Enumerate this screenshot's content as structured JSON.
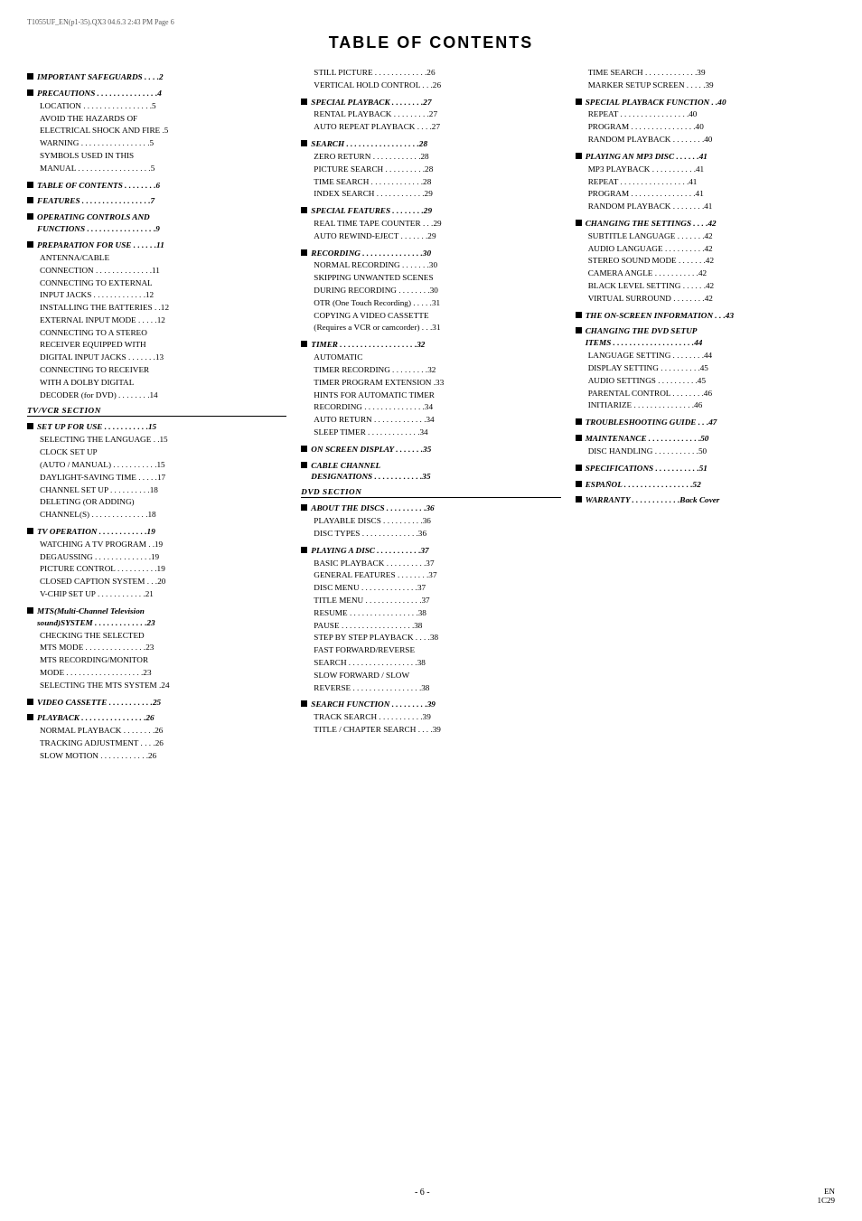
{
  "header": {
    "left": "T1055UF_EN(p1-35).QX3   04.6.3   2:43 PM   Page 6"
  },
  "title": "TABLE OF CONTENTS",
  "footer": {
    "center": "- 6 -",
    "right_line1": "EN",
    "right_line2": "1C29"
  },
  "col1": [
    {
      "type": "section",
      "text": "IMPORTANT SAFEGUARDS  . . . .2"
    },
    {
      "type": "section",
      "text": "PRECAUTIONS  . . . . . . . . . . . . . . .4"
    },
    {
      "type": "sub",
      "text": "LOCATION  . . . . . . . . . . . . . . . . .5"
    },
    {
      "type": "sub",
      "text": "AVOID THE HAZARDS OF\nELECTRICAL SHOCK AND FIRE  .5"
    },
    {
      "type": "sub",
      "text": "WARNING  . . . . . . . . . . . . . . . . .5"
    },
    {
      "type": "sub",
      "text": "SYMBOLS USED IN THIS\nMANUAL . . . . . . . . . . . . . . . . . .5"
    },
    {
      "type": "section",
      "text": "TABLE OF CONTENTS  . . . . . . . .6"
    },
    {
      "type": "section",
      "text": "FEATURES . . . . . . . . . . . . . . . . .7"
    },
    {
      "type": "section",
      "text": "OPERATING CONTROLS AND\nFUNCTIONS . . . . . . . . . . . . . . . . .9"
    },
    {
      "type": "section",
      "text": "PREPARATION FOR USE  . . . . . .11"
    },
    {
      "type": "sub",
      "text": "ANTENNA/CABLE\nCONNECTION . . . . . . . . . . . . . .11"
    },
    {
      "type": "sub",
      "text": "CONNECTING TO EXTERNAL\nINPUT JACKS  . . . . . . . . . . . . .12"
    },
    {
      "type": "sub",
      "text": "INSTALLING THE BATTERIES  . .12"
    },
    {
      "type": "sub",
      "text": "EXTERNAL INPUT MODE  . . . . .12"
    },
    {
      "type": "sub",
      "text": "CONNECTING TO A STEREO\nRECEIVER EQUIPPED WITH\nDIGITAL INPUT JACKS  . . . . . . .13"
    },
    {
      "type": "sub",
      "text": "CONNECTING TO RECEIVER\nWITH A DOLBY DIGITAL\nDECODER (for DVD)  . . . . . . . .14"
    },
    {
      "type": "divider",
      "text": "TV/VCR SECTION"
    },
    {
      "type": "section",
      "text": "SET UP FOR USE  . . . . . . . . . . .15"
    },
    {
      "type": "sub",
      "text": "SELECTING THE LANGUAGE  . .15"
    },
    {
      "type": "sub",
      "text": "CLOCK SET UP\n(AUTO / MANUAL) . . . . . . . . . . .15"
    },
    {
      "type": "sub",
      "text": "DAYLIGHT-SAVING TIME  . . . . .17"
    },
    {
      "type": "sub",
      "text": "CHANNEL SET UP  . . . . . . . . . .18"
    },
    {
      "type": "sub",
      "text": "DELETING (OR ADDING)\nCHANNEL(S) . . . . . . . . . . . . . .18"
    },
    {
      "type": "section",
      "text": "TV OPERATION  . . . . . . . . . . . .19"
    },
    {
      "type": "sub",
      "text": "WATCHING A TV PROGRAM  . .19"
    },
    {
      "type": "sub",
      "text": "DEGAUSSING  . . . . . . . . . . . . . .19"
    },
    {
      "type": "sub",
      "text": "PICTURE CONTROL . . . . . . . . . .19"
    },
    {
      "type": "sub",
      "text": "CLOSED CAPTION SYSTEM  . . .20"
    },
    {
      "type": "sub",
      "text": "V-CHIP SET UP  . . . . . . . . . . . .21"
    },
    {
      "type": "section",
      "text": "MTS(Multi-Channel Television\nsound)SYSTEM  . . . . . . . . . . . . .23"
    },
    {
      "type": "sub",
      "text": "CHECKING THE SELECTED\nMTS MODE  . . . . . . . . . . . . . . .23"
    },
    {
      "type": "sub",
      "text": "MTS RECORDING/MONITOR\nMODE  . . . . . . . . . . . . . . . . . . .23"
    },
    {
      "type": "sub",
      "text": "SELECTING THE MTS SYSTEM  .24"
    },
    {
      "type": "section",
      "text": "VIDEO CASSETTE . . . . . . . . . . .25"
    },
    {
      "type": "section",
      "text": "PLAYBACK  . . . . . . . . . . . . . . . .26"
    },
    {
      "type": "sub",
      "text": "NORMAL PLAYBACK  . . . . . . . .26"
    },
    {
      "type": "sub",
      "text": "TRACKING ADJUSTMENT  . . . .26"
    },
    {
      "type": "sub",
      "text": "SLOW MOTION  . . . . . . . . . . . .26"
    }
  ],
  "col2": [
    {
      "type": "sub",
      "text": "STILL PICTURE  . . . . . . . . . . . . .26"
    },
    {
      "type": "sub",
      "text": "VERTICAL HOLD CONTROL  . . .26"
    },
    {
      "type": "section",
      "text": "SPECIAL PLAYBACK  . . . . . . . .27"
    },
    {
      "type": "sub",
      "text": "RENTAL PLAYBACK  . . . . . . . . .27"
    },
    {
      "type": "sub",
      "text": "AUTO REPEAT PLAYBACK  . . . .27"
    },
    {
      "type": "section",
      "text": "SEARCH  . . . . . . . . . . . . . . . . . .28"
    },
    {
      "type": "sub",
      "text": "ZERO RETURN  . . . . . . . . . . . .28"
    },
    {
      "type": "sub",
      "text": "PICTURE SEARCH  . . . . . . . . . .28"
    },
    {
      "type": "sub",
      "text": "TIME SEARCH  . . . . . . . . . . . . .28"
    },
    {
      "type": "sub",
      "text": "INDEX SEARCH  . . . . . . . . . . . .29"
    },
    {
      "type": "section",
      "text": "SPECIAL FEATURES  . . . . . . . .29"
    },
    {
      "type": "sub",
      "text": "REAL TIME TAPE COUNTER  . . .29"
    },
    {
      "type": "sub",
      "text": "AUTO REWIND-EJECT  . . . . . . .29"
    },
    {
      "type": "section",
      "text": "RECORDING  . . . . . . . . . . . . . . .30"
    },
    {
      "type": "sub",
      "text": "NORMAL RECORDING  . . . . . . .30"
    },
    {
      "type": "sub",
      "text": "SKIPPING UNWANTED SCENES\nDURING RECORDING  . . . . . . . .30"
    },
    {
      "type": "sub",
      "text": "OTR (One Touch Recording) . . . . .31"
    },
    {
      "type": "sub",
      "text": "COPYING A VIDEO CASSETTE\n(Requires a VCR or camcorder)  . . .31"
    },
    {
      "type": "section",
      "text": "TIMER  . . . . . . . . . . . . . . . . . . .32"
    },
    {
      "type": "sub",
      "text": "AUTOMATIC\nTIMER RECORDING  . . . . . . . . .32"
    },
    {
      "type": "sub",
      "text": "TIMER PROGRAM EXTENSION  .33"
    },
    {
      "type": "sub",
      "text": "HINTS FOR AUTOMATIC TIMER\nRECORDING . . . . . . . . . . . . . . .34"
    },
    {
      "type": "sub",
      "text": "AUTO RETURN . . . . . . . . . . . . .34"
    },
    {
      "type": "sub",
      "text": "SLEEP TIMER  . . . . . . . . . . . . .34"
    },
    {
      "type": "section",
      "text": "ON SCREEN DISPLAY  . . . . . . .35"
    },
    {
      "type": "section",
      "text": "CABLE CHANNEL\nDESIGNATIONS  . . . . . . . . . . . .35"
    },
    {
      "type": "divider",
      "text": "DVD SECTION"
    },
    {
      "type": "section",
      "text": "ABOUT THE DISCS  . . . . . . . . . .36"
    },
    {
      "type": "sub",
      "text": "PLAYABLE DISCS  . . . . . . . . . .36"
    },
    {
      "type": "sub",
      "text": "DISC TYPES  . . . . . . . . . . . . . .36"
    },
    {
      "type": "section",
      "text": "PLAYING A DISC  . . . . . . . . . . .37"
    },
    {
      "type": "sub",
      "text": "BASIC PLAYBACK  . . . . . . . . . .37"
    },
    {
      "type": "sub",
      "text": "GENERAL FEATURES  . . . . . . . .37"
    },
    {
      "type": "sub",
      "text": "DISC MENU  . . . . . . . . . . . . . .37"
    },
    {
      "type": "sub",
      "text": "TITLE MENU  . . . . . . . . . . . . . .37"
    },
    {
      "type": "sub",
      "text": "RESUME  . . . . . . . . . . . . . . . . .38"
    },
    {
      "type": "sub",
      "text": "PAUSE  . . . . . . . . . . . . . . . . . .38"
    },
    {
      "type": "sub",
      "text": "STEP BY STEP PLAYBACK  . . . .38"
    },
    {
      "type": "sub",
      "text": "FAST FORWARD/REVERSE\nSEARCH  . . . . . . . . . . . . . . . . .38"
    },
    {
      "type": "sub",
      "text": "SLOW FORWARD / SLOW\nREVERSE . . . . . . . . . . . . . . . . .38"
    },
    {
      "type": "section",
      "text": "SEARCH FUNCTION . . . . . . . . .39"
    },
    {
      "type": "sub",
      "text": "TRACK SEARCH  . . . . . . . . . . .39"
    },
    {
      "type": "sub",
      "text": "TITLE / CHAPTER SEARCH  . . . .39"
    }
  ],
  "col3": [
    {
      "type": "sub",
      "text": "TIME SEARCH  . . . . . . . . . . . . .39"
    },
    {
      "type": "sub",
      "text": "MARKER SETUP SCREEN  . . . . .39"
    },
    {
      "type": "section",
      "text": "SPECIAL PLAYBACK FUNCTION  . .40"
    },
    {
      "type": "sub",
      "text": "REPEAT  . . . . . . . . . . . . . . . . .40"
    },
    {
      "type": "sub",
      "text": "PROGRAM . . . . . . . . . . . . . . . .40"
    },
    {
      "type": "sub",
      "text": "RANDOM PLAYBACK  . . . . . . . .40"
    },
    {
      "type": "section",
      "text": "PLAYING AN MP3 DISC  . . . . . .41"
    },
    {
      "type": "sub",
      "text": "MP3 PLAYBACK  . . . . . . . . . . .41"
    },
    {
      "type": "sub",
      "text": "REPEAT  . . . . . . . . . . . . . . . . .41"
    },
    {
      "type": "sub",
      "text": "PROGRAM . . . . . . . . . . . . . . . .41"
    },
    {
      "type": "sub",
      "text": "RANDOM PLAYBACK  . . . . . . . .41"
    },
    {
      "type": "section",
      "text": "CHANGING THE SETTINGS  . . . .42"
    },
    {
      "type": "sub",
      "text": "SUBTITLE LANGUAGE  . . . . . . .42"
    },
    {
      "type": "sub",
      "text": "AUDIO LANGUAGE . . . . . . . . . .42"
    },
    {
      "type": "sub",
      "text": "STEREO SOUND MODE . . . . . . .42"
    },
    {
      "type": "sub",
      "text": "CAMERA ANGLE  . . . . . . . . . . .42"
    },
    {
      "type": "sub",
      "text": "BLACK LEVEL SETTING  . . . . . .42"
    },
    {
      "type": "sub",
      "text": "VIRTUAL SURROUND  . . . . . . . .42"
    },
    {
      "type": "section",
      "text": "THE ON-SCREEN INFORMATION  . . .43"
    },
    {
      "type": "section",
      "text": "CHANGING THE DVD SETUP\nITEMS . . . . . . . . . . . . . . . . . . . .44"
    },
    {
      "type": "sub",
      "text": "LANGUAGE SETTING  . . . . . . . .44"
    },
    {
      "type": "sub",
      "text": "DISPLAY SETTING  . . . . . . . . . .45"
    },
    {
      "type": "sub",
      "text": "AUDIO SETTINGS  . . . . . . . . . .45"
    },
    {
      "type": "sub",
      "text": "PARENTAL CONTROL  . . . . . . . .46"
    },
    {
      "type": "sub",
      "text": "INITIARIZE  . . . . . . . . . . . . . . .46"
    },
    {
      "type": "section",
      "text": "TROUBLESHOOTING GUIDE  . . .47"
    },
    {
      "type": "section",
      "text": "MAINTENANCE . . . . . . . . . . . . .50"
    },
    {
      "type": "sub",
      "text": "DISC HANDLING  . . . . . . . . . . .50"
    },
    {
      "type": "section",
      "text": "SPECIFICATIONS  . . . . . . . . . . .51"
    },
    {
      "type": "section",
      "text": "ESPAÑOL  . . . . . . . . . . . . . . . . .52"
    },
    {
      "type": "section",
      "text": "WARRANTY  . . . . . . . . . . . .Back Cover"
    }
  ]
}
